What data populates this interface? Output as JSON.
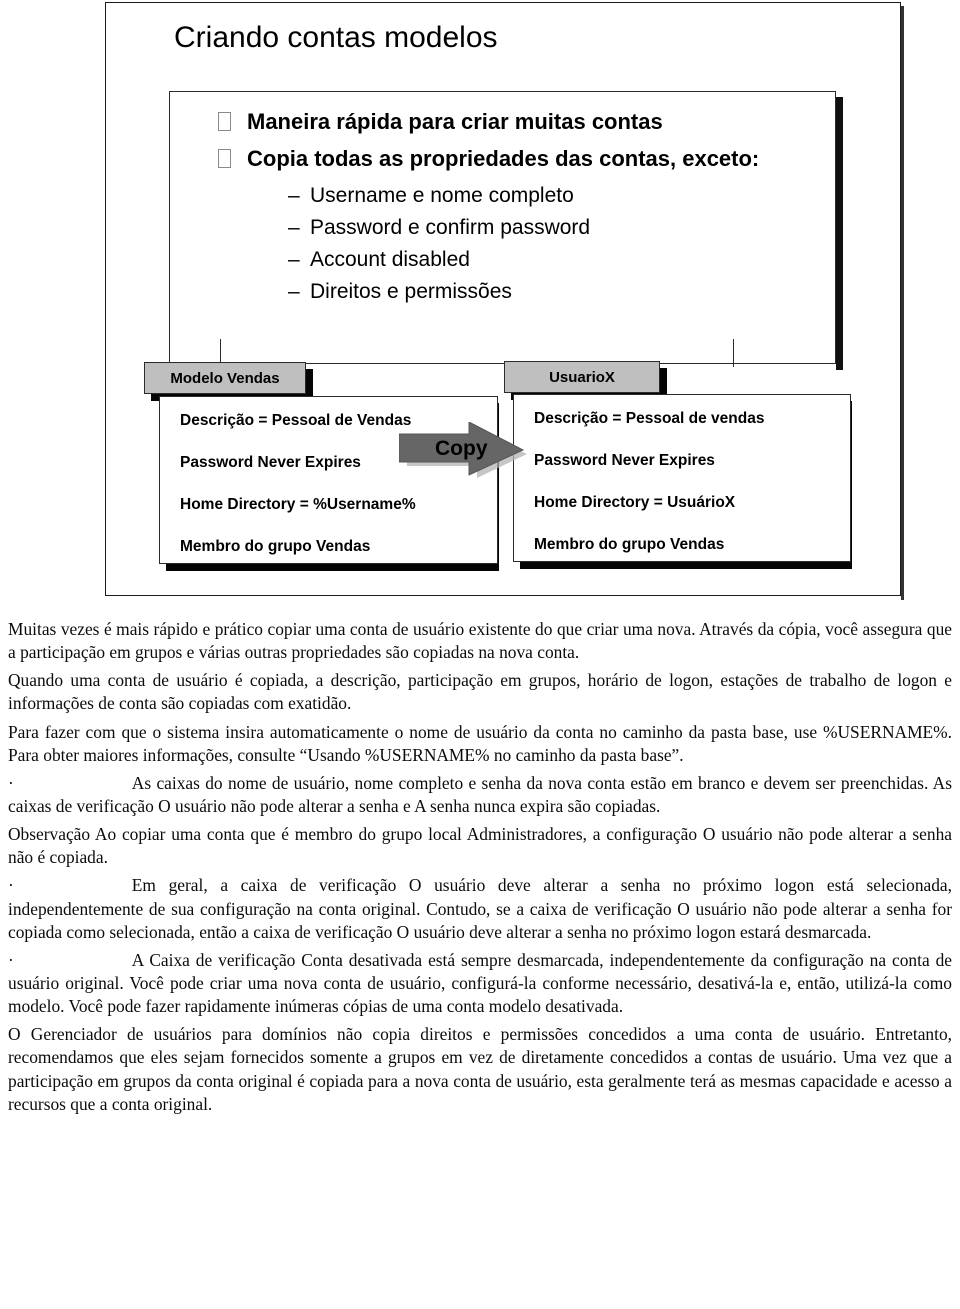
{
  "slide": {
    "title": "Criando contas modelos",
    "bullets": {
      "level1": [
        "Maneira rápida para criar muitas contas",
        "Copia todas as propriedades das contas, exceto:"
      ],
      "level2": [
        "Username e nome completo",
        "Password e confirm password",
        "Account disabled",
        "Direitos e permissões"
      ],
      "dash_glyph": "–"
    },
    "diagram": {
      "arrow_label": "Copy",
      "left_card": {
        "tab_label": "Modelo Vendas",
        "lines": [
          "Descrição = Pessoal de Vendas",
          "Password Never Expires",
          "Home Directory = %Username%",
          "Membro do grupo Vendas"
        ]
      },
      "right_card": {
        "tab_label": "UsuarioX",
        "lines": [
          "Descrição = Pessoal de vendas",
          "Password Never Expires",
          "Home Directory = UsuárioX",
          "Membro do grupo Vendas"
        ]
      }
    },
    "colors": {
      "tab_fill": "#bfbfbf",
      "arrow_fill": "#666666",
      "border": "#2b2b2b",
      "shadow": "#050505"
    }
  },
  "body": {
    "paragraphs": [
      "Muitas vezes é mais rápido e prático copiar uma conta de usuário existente do que criar uma nova. Através da cópia, você assegura que a participação em grupos e várias outras propriedades são copiadas na nova conta.",
      "Quando uma conta de usuário é copiada, a descrição, participação em grupos, horário de logon, estações de trabalho de logon e informações de conta são copiadas com exatidão.",
      "Para fazer com que o sistema insira automaticamente o nome de usuário da conta no caminho da pasta base, use %USERNAME%. Para obter maiores informações, consulte “Usando %USERNAME% no caminho da pasta base”.",
      "As caixas do nome de usuário, nome completo e senha da nova conta estão em branco e devem ser preenchidas. As caixas de verificação O usuário não pode alterar a senha e A senha nunca expira são copiadas.",
      "Observação  Ao copiar uma conta que é membro do grupo local Administradores, a configuração O usuário não pode alterar a senha não é copiada.",
      "Em geral, a caixa de verificação O usuário deve alterar a senha no próximo logon está selecionada, independentemente de sua configuração na conta original. Contudo, se a caixa de verificação O usuário não pode alterar a senha for copiada como selecionada, então a caixa de verificação O usuário deve alterar a senha no próximo logon estará desmarcada.",
      "A Caixa de verificação Conta desativada está sempre desmarcada, independentemente da configuração na conta de usuário original. Você pode criar uma nova conta de usuário, configurá-la conforme necessário, desativá-la e, então, utilizá-la como modelo. Você pode fazer rapidamente inúmeras cópias de uma conta modelo desativada.",
      "O Gerenciador de usuários para domínios não copia direitos e permissões concedidos a uma conta de usuário. Entretanto, recomendamos que eles sejam fornecidos somente a grupos em vez de diretamente concedidos a contas de usuário. Uma vez que a participação em grupos da conta original é copiada para a nova conta de usuário, esta geralmente terá as mesmas capacidade e acesso a recursos que a conta original."
    ],
    "bullet_marker": "·"
  }
}
